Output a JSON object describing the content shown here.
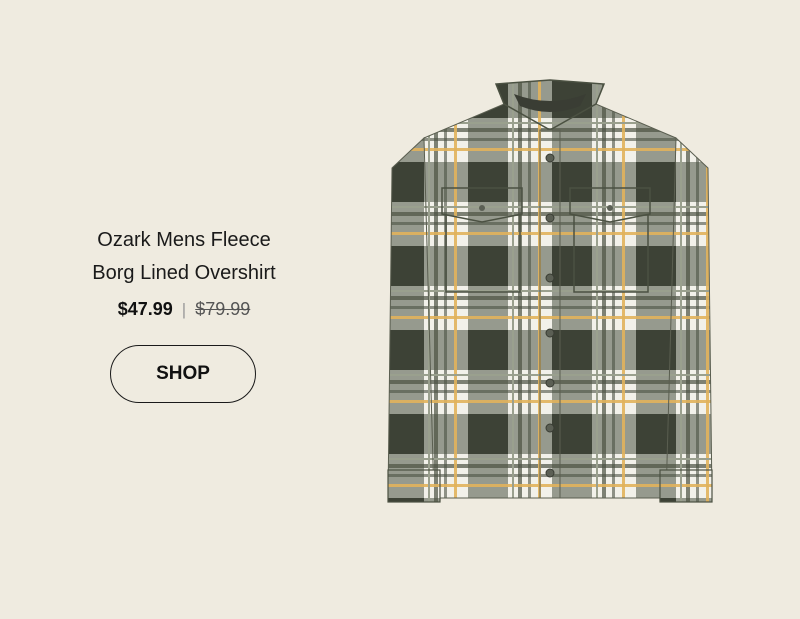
{
  "product": {
    "title_line1": "Ozark Mens Fleece",
    "title_line2": "Borg Lined Overshirt",
    "sale_price": "$47.99",
    "separator": "|",
    "original_price": "$79.99",
    "image_icon": "plaid-overshirt-image"
  },
  "cta": {
    "shop_label": "SHOP"
  },
  "colors": {
    "background": "#efebe0",
    "text": "#1a1a1a",
    "plaid_dark": "#4b5142",
    "plaid_light": "#f2f1ea",
    "plaid_mid": "#9aa08e",
    "plaid_accent": "#e2b35c"
  }
}
